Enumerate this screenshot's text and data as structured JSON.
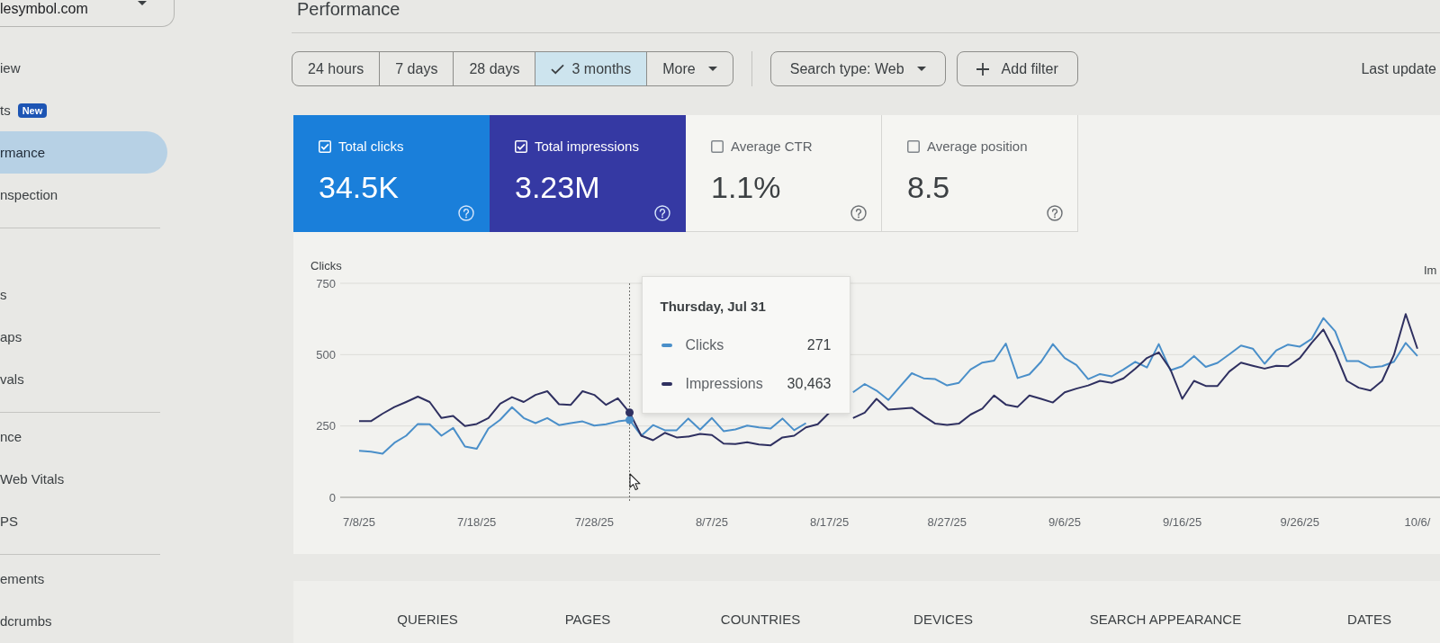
{
  "sidebar": {
    "property": "lesymbol.com",
    "sections": [
      {
        "items": [
          {
            "label": "iew",
            "selected": false
          },
          {
            "label": "ts",
            "badge": "New",
            "selected": false
          },
          {
            "label": "rmance",
            "selected": true
          },
          {
            "label": "nspection",
            "selected": false
          }
        ]
      },
      {
        "items": [
          {
            "label": "s",
            "selected": false
          },
          {
            "label": "aps",
            "selected": false
          },
          {
            "label": "vals",
            "selected": false
          }
        ]
      },
      {
        "header": "nce",
        "items": [
          {
            "label": "Web Vitals",
            "selected": false
          },
          {
            "label": "PS",
            "selected": false
          }
        ]
      },
      {
        "header": "ements",
        "items": [
          {
            "label": "dcrumbs",
            "selected": false
          }
        ]
      }
    ]
  },
  "page": {
    "title": "Performance"
  },
  "toolbar": {
    "date_ranges": [
      {
        "label": "24 hours",
        "selected": false
      },
      {
        "label": "7 days",
        "selected": false
      },
      {
        "label": "28 days",
        "selected": false
      },
      {
        "label": "3 months",
        "selected": true
      }
    ],
    "more": "More",
    "search_type": "Search type: Web",
    "add_filter": "Add filter",
    "last_update": "Last update"
  },
  "metrics": [
    {
      "label": "Total clicks",
      "value": "34.5K",
      "checked": true,
      "color": "#1a7fda"
    },
    {
      "label": "Total impressions",
      "value": "3.23M",
      "checked": true,
      "color": "#3539a3"
    },
    {
      "label": "Average CTR",
      "value": "1.1%",
      "checked": false
    },
    {
      "label": "Average position",
      "value": "8.5",
      "checked": false
    }
  ],
  "chart": {
    "right_axis_title": "Im",
    "chart_data": {
      "type": "line",
      "ylabel": "Clicks",
      "categories": [
        "7/8/25",
        null,
        null,
        null,
        null,
        null,
        null,
        null,
        null,
        null,
        "7/18/25",
        null,
        null,
        null,
        null,
        null,
        null,
        null,
        null,
        null,
        "7/28/25",
        null,
        null,
        null,
        null,
        null,
        null,
        null,
        null,
        null,
        "8/7/25",
        null,
        null,
        null,
        null,
        null,
        null,
        null,
        null,
        null,
        "8/17/25",
        null,
        null,
        null,
        null,
        null,
        null,
        null,
        null,
        null,
        "8/27/25",
        null,
        null,
        null,
        null,
        null,
        null,
        null,
        null,
        null,
        "9/6/25",
        null,
        null,
        null,
        null,
        null,
        null,
        null,
        null,
        null,
        "9/16/25",
        null,
        null,
        null,
        null,
        null,
        null,
        null,
        null,
        null,
        "9/26/25",
        null,
        null,
        null,
        null,
        null,
        null,
        null,
        null,
        null,
        "10/6/"
      ],
      "ylim": [
        0,
        750
      ],
      "yticks": [
        0,
        250,
        500,
        750
      ],
      "legend": "upper left",
      "series": [
        {
          "name": "Clicks",
          "color": "#4a8fc9",
          "values": [
            163,
            160,
            153,
            191,
            216,
            257,
            256,
            216,
            243,
            178,
            170,
            241,
            272,
            316,
            278,
            260,
            278,
            253,
            260,
            266,
            251,
            256,
            266,
            271,
            216,
            253,
            235,
            235,
            276,
            237,
            278,
            232,
            238,
            251,
            245,
            241,
            276,
            235,
            260,
            null,
            null,
            null,
            368,
            397,
            374,
            341,
            388,
            435,
            417,
            414,
            392,
            401,
            448,
            472,
            479,
            539,
            418,
            431,
            475,
            537,
            488,
            464,
            414,
            432,
            424,
            448,
            475,
            455,
            537,
            445,
            459,
            495,
            457,
            471,
            501,
            532,
            521,
            468,
            515,
            535,
            528,
            555,
            628,
            582,
            477,
            477,
            455,
            459,
            475,
            541,
            495
          ]
        },
        {
          "name": "Impressions",
          "color": "#2f3060",
          "values": [
            267,
            267,
            293,
            316,
            334,
            353,
            334,
            278,
            285,
            250,
            257,
            278,
            328,
            351,
            334,
            359,
            372,
            326,
            324,
            372,
            359,
            324,
            347,
            297,
            216,
            200,
            226,
            210,
            213,
            222,
            218,
            188,
            187,
            193,
            185,
            182,
            210,
            216,
            245,
            256,
            297,
            null,
            278,
            297,
            345,
            307,
            310,
            314,
            285,
            258,
            254,
            258,
            290,
            311,
            357,
            325,
            317,
            357,
            345,
            332,
            368,
            381,
            392,
            408,
            401,
            417,
            451,
            488,
            508,
            448,
            345,
            408,
            390,
            390,
            441,
            472,
            461,
            451,
            461,
            459,
            488,
            541,
            588,
            508,
            408,
            384,
            374,
            408,
            499,
            642,
            521
          ]
        }
      ]
    },
    "tooltip": {
      "title": "Thursday, Jul 31",
      "values": [
        "271",
        "30,463"
      ]
    }
  },
  "report_tabs": [
    "QUERIES",
    "PAGES",
    "COUNTRIES",
    "DEVICES",
    "SEARCH APPEARANCE",
    "DATES"
  ]
}
